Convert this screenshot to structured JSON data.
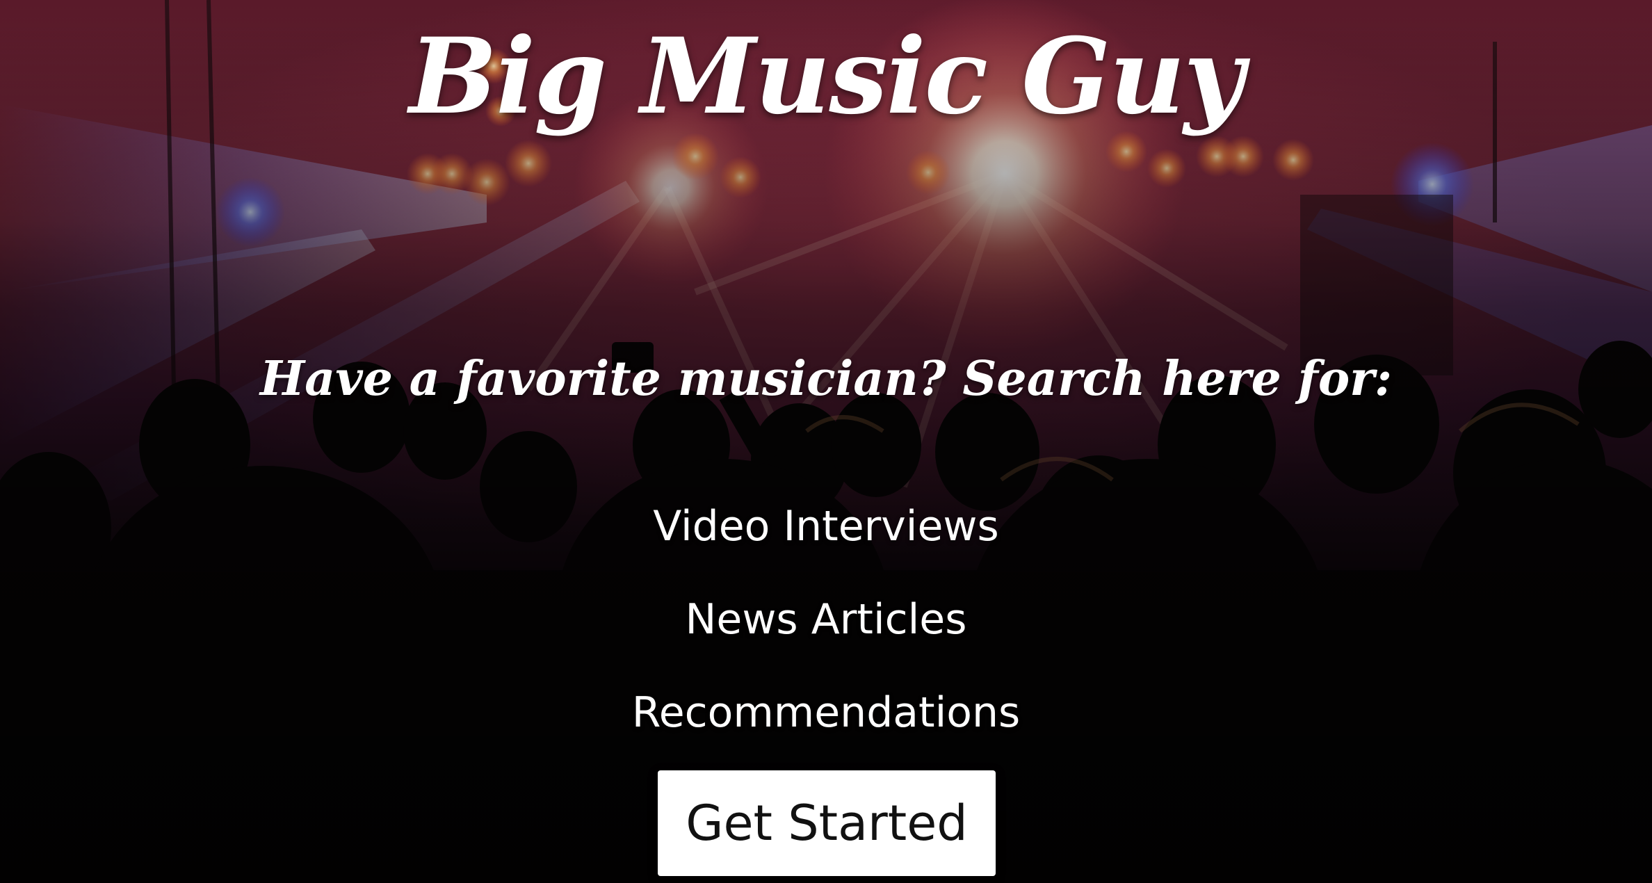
{
  "hero": {
    "title": "Big Music Guy",
    "tagline": "Have a favorite musician? Search here for:",
    "features": [
      "Video Interviews",
      "News Articles",
      "Recommendations"
    ],
    "cta_label": "Get Started"
  },
  "background": {
    "description": "concert-crowd-photo",
    "stage_light_colors": [
      "#ffffff",
      "#ffb070",
      "#ff4a5a",
      "#6a7cff"
    ]
  }
}
